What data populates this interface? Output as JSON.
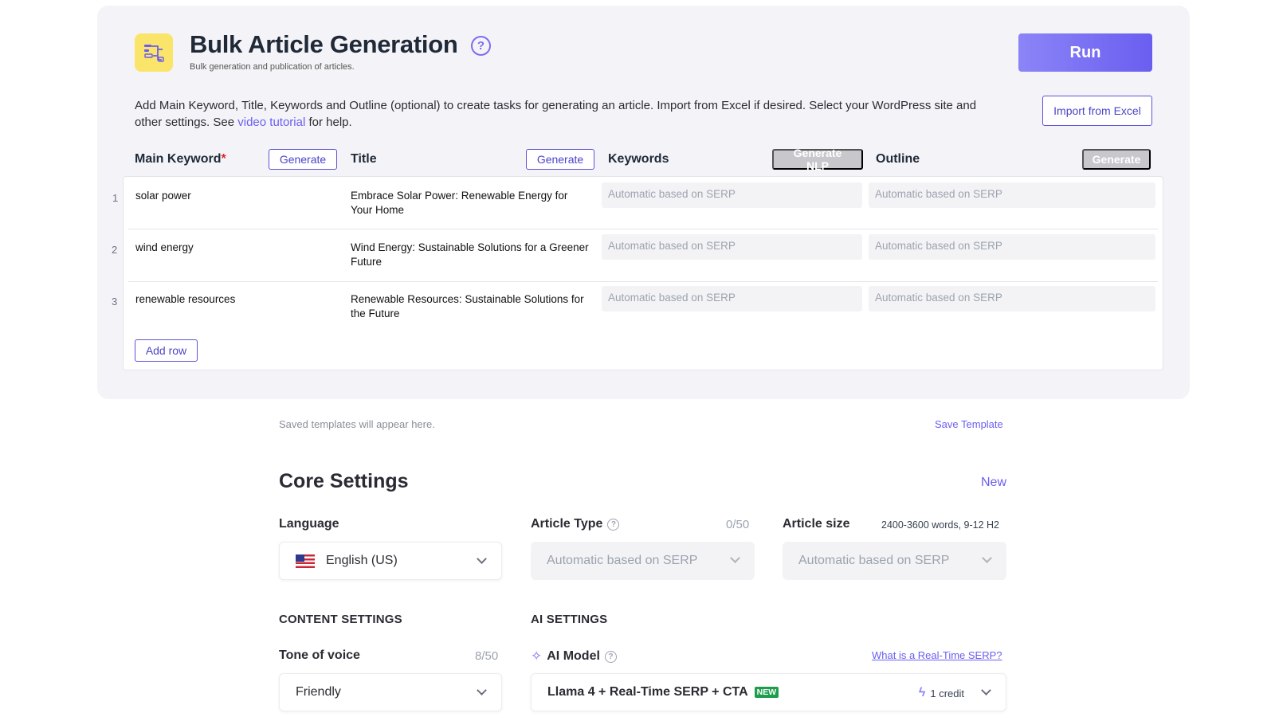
{
  "header": {
    "title": "Bulk Article Generation",
    "subtitle": "Bulk generation and publication of articles.",
    "run_label": "Run",
    "import_label": "Import from Excel"
  },
  "intro": {
    "text_before": "Add Main Keyword, Title, Keywords and Outline (optional) to create tasks for generating an article. Import from Excel if desired. Select your WordPress site and other settings. See ",
    "link_text": "video tutorial",
    "text_after": " for help."
  },
  "columns": {
    "main_keyword": "Main Keyword",
    "required_mark": "*",
    "title": "Title",
    "keywords": "Keywords",
    "outline": "Outline",
    "generate_label": "Generate",
    "generate_nlp_label": "Generate NLP"
  },
  "rows": [
    {
      "num": "1",
      "keyword": "solar power",
      "title": "Embrace Solar Power: Renewable Energy for Your Home",
      "keywords": "Automatic based on SERP",
      "outline": "Automatic based on SERP"
    },
    {
      "num": "2",
      "keyword": "wind energy",
      "title": "Wind Energy: Sustainable Solutions for a Greener Future",
      "keywords": "Automatic based on SERP",
      "outline": "Automatic based on SERP"
    },
    {
      "num": "3",
      "keyword": "renewable resources",
      "title": "Renewable Resources: Sustainable Solutions for the Future",
      "keywords": "Automatic based on SERP",
      "outline": "Automatic based on SERP"
    }
  ],
  "add_row_label": "Add row",
  "templates": {
    "saved_note": "Saved templates will appear here.",
    "save_label": "Save Template"
  },
  "core": {
    "title": "Core Settings",
    "new_label": "New",
    "language_label": "Language",
    "language_value": "English (US)",
    "article_type_label": "Article Type",
    "article_type_counter": "0/50",
    "article_type_value": "Automatic based on SERP",
    "article_size_label": "Article size",
    "article_size_note": "2400-3600 words, 9-12 H2",
    "article_size_value": "Automatic based on SERP"
  },
  "content_settings": {
    "heading": "CONTENT SETTINGS",
    "tone_label": "Tone of voice",
    "tone_counter": "8/50",
    "tone_value": "Friendly"
  },
  "ai_settings": {
    "heading": "AI SETTINGS",
    "model_label": "AI Model",
    "serp_link": "What is a Real-Time SERP?",
    "model_value": "Llama 4 + Real-Time SERP + CTA",
    "new_badge": "NEW",
    "credit": "1 credit"
  },
  "colors": {
    "accent": "#6a5ef0",
    "app_icon_bg": "#fbe46a",
    "new_badge_bg": "#1d9e4c",
    "required": "#dc2626"
  },
  "icons": [
    "bulk-article-icon",
    "help-circle-icon",
    "us-flag-icon",
    "chevron-down-icon",
    "sparkle-icon",
    "lightning-icon"
  ]
}
